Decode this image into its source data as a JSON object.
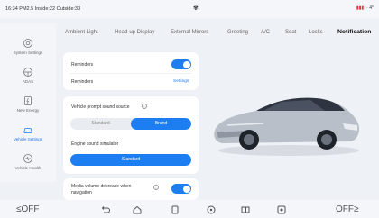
{
  "status": {
    "left_text": "16:34  PM2.5 Inside:22  Outside:33",
    "center_icon": "wind-icon",
    "right_text": "· 4°"
  },
  "sidebar": {
    "items": [
      {
        "label": "System Settings",
        "icon": "gear-icon"
      },
      {
        "label": "ADAS",
        "icon": "steering-wheel-icon"
      },
      {
        "label": "New Energy",
        "icon": "battery-icon"
      },
      {
        "label": "Vehicle Settings",
        "icon": "car-icon",
        "active": true
      },
      {
        "label": "Vehicle Health",
        "icon": "health-icon"
      }
    ]
  },
  "tabs": [
    {
      "label": "Ambient Light"
    },
    {
      "label": "Head-up Display"
    },
    {
      "label": "External Mirrors"
    },
    {
      "label": "Greeting"
    },
    {
      "label": "A/C"
    },
    {
      "label": "Seat"
    },
    {
      "label": "Locks"
    },
    {
      "label": "Notification",
      "active": true
    }
  ],
  "reminders_card": {
    "reminders_label": "Reminders",
    "reminders_toggle": true,
    "reminders_row2_label": "Reminders",
    "settings_link": "Settings"
  },
  "sound_card": {
    "prompt_label": "Vehicle prompt sound source",
    "options": [
      "Standard",
      "Brand"
    ],
    "selected": "Brand",
    "simulator_label": "Engine sound simulator",
    "simulator_value": "Standard"
  },
  "media_card": {
    "label_line1": "Media volume decrease when",
    "label_line2": "navigation",
    "toggle": true
  },
  "bottom": {
    "left_temp": "OFF",
    "right_temp": "OFF",
    "nav_icons": [
      "back-icon",
      "home-icon",
      "recent-apps-icon",
      "steering-icon",
      "split-screen-icon",
      "fan-icon"
    ]
  },
  "colors": {
    "accent": "#1c7ef0",
    "background": "#eef1f5"
  }
}
